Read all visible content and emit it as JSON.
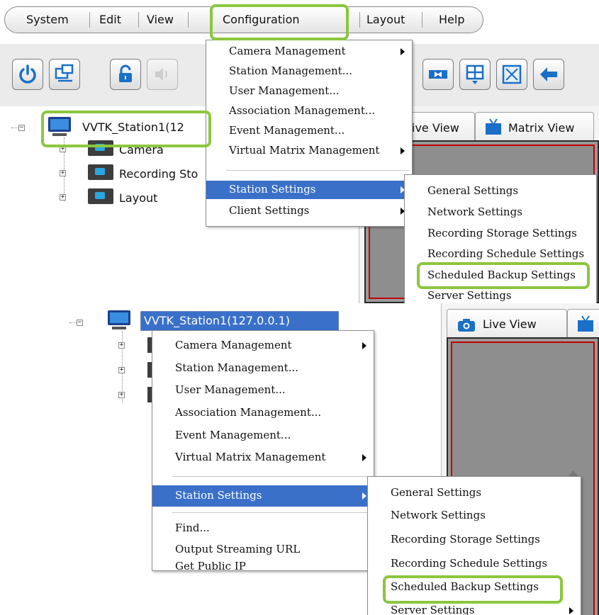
{
  "menubar": {
    "items": [
      "System",
      "Edit",
      "View",
      "Configuration",
      "Layout",
      "Help"
    ]
  },
  "top": {
    "station_label": "VVTK_Station1(12",
    "tree_items": [
      "Camera",
      "Recording Sto",
      "Layout"
    ],
    "tabs": {
      "live_view": "ive View",
      "matrix_view": "Matrix View"
    },
    "config_menu": {
      "items": [
        "Camera Management",
        "Station Management...",
        "User Management...",
        "Association Management...",
        "Event Management...",
        "Virtual Matrix Management",
        "Station Settings",
        "Client Settings"
      ]
    },
    "station_submenu": {
      "items": [
        "General Settings",
        "Network Settings",
        "Recording Storage Settings",
        "Recording Schedule Settings",
        "Scheduled Backup Settings",
        "Server Settings"
      ]
    }
  },
  "bottom": {
    "station_label": "VVTK_Station1(127.0.0.1)",
    "tabs": {
      "live_view": "Live View"
    },
    "context_menu": {
      "items": [
        "Camera Management",
        "Station Management...",
        "User Management...",
        "Association Management...",
        "Event Management...",
        "Virtual Matrix Management",
        "Station Settings",
        "Find...",
        "Output Streaming URL",
        "Get Public IP"
      ]
    },
    "station_submenu": {
      "items": [
        "General Settings",
        "Network Settings",
        "Recording Storage Settings",
        "Recording Schedule Settings",
        "Scheduled Backup Settings",
        "Server Settings"
      ]
    }
  },
  "colors": {
    "highlight": "#8cc63f",
    "selection": "#3a70c8",
    "viewport_border": "#c00000"
  },
  "icons": [
    "power-icon",
    "monitor-network-icon",
    "lock-icon",
    "speaker-icon",
    "swap-arrows-icon",
    "grid-layout-icon",
    "fullscreen-icon",
    "back-arrow-icon",
    "computer-icon",
    "folder-icon",
    "camera-icon",
    "matrix-tv-icon"
  ]
}
